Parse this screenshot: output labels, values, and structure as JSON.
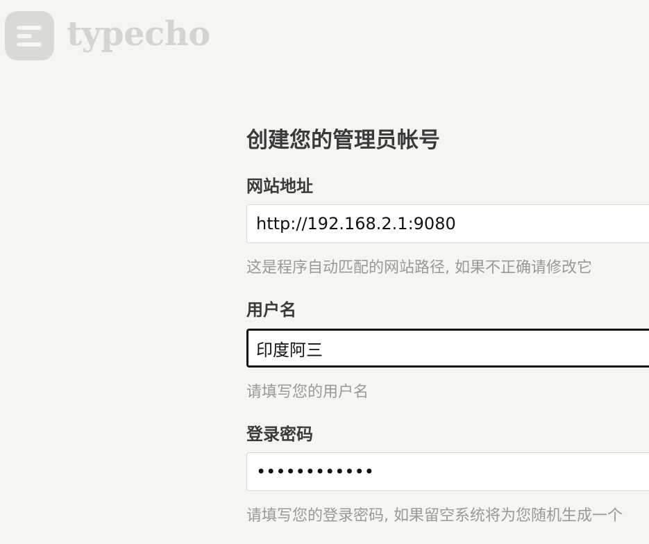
{
  "brand": {
    "name": "typecho",
    "icon": "typecho-logo-icon"
  },
  "form": {
    "title": "创建您的管理员帐号",
    "site_url": {
      "label": "网站地址",
      "value": "http://192.168.2.1:9080",
      "hint": "这是程序自动匹配的网站路径, 如果不正确请修改它"
    },
    "username": {
      "label": "用户名",
      "value": "印度阿三",
      "hint": "请填写您的用户名"
    },
    "password": {
      "label": "登录密码",
      "value": "••••••••••••",
      "hint": "请填写您的登录密码, 如果留空系统将为您随机生成一个"
    }
  },
  "colors": {
    "background": "#f5f5f2",
    "logo": "#d9d9d6",
    "focus_border": "#111111",
    "hint_text": "#999999"
  }
}
